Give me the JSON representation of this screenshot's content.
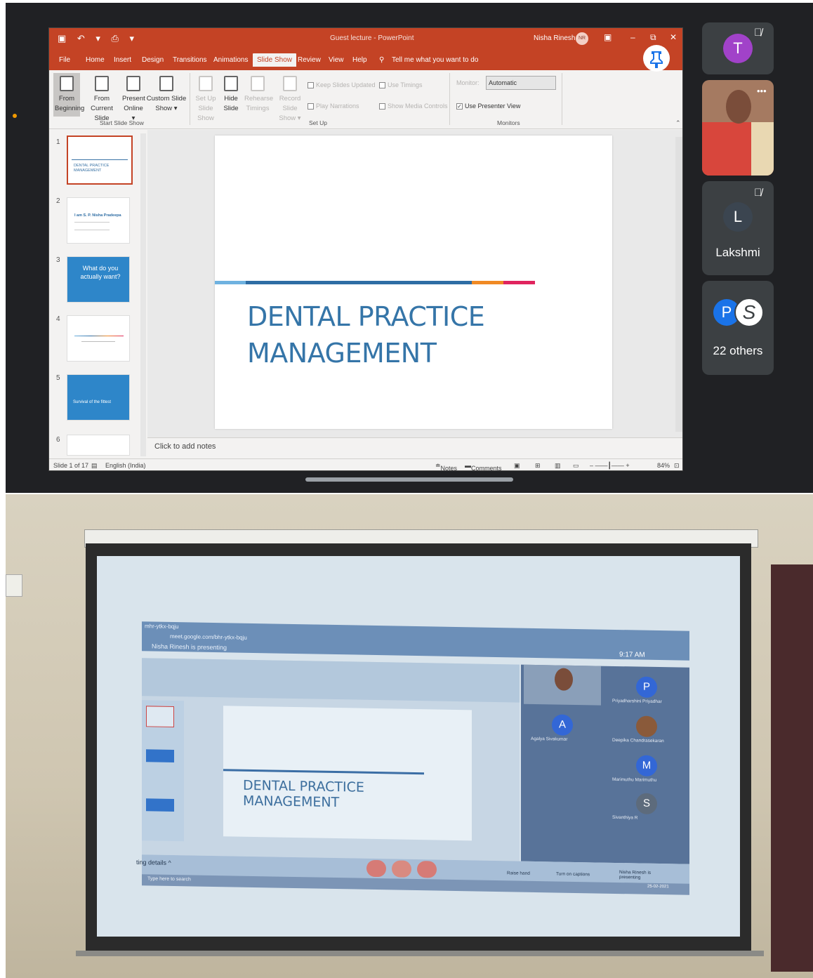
{
  "top": {
    "powerpoint": {
      "doc_title": "Guest lecture - PowerPoint",
      "user_name": "Nisha Rinesh",
      "user_initials": "NR",
      "tabs": [
        "File",
        "Home",
        "Insert",
        "Design",
        "Transitions",
        "Animations",
        "Slide Show",
        "Review",
        "View",
        "Help"
      ],
      "active_tab": "Slide Show",
      "tell_me": "Tell me what you want to do",
      "ribbon": {
        "from_beginning": [
          "From",
          "Beginning"
        ],
        "from_current": [
          "From",
          "Current Slide"
        ],
        "present_online": [
          "Present",
          "Online ▾"
        ],
        "custom_show": [
          "Custom Slide",
          "Show ▾"
        ],
        "set_up_show": [
          "Set Up",
          "Slide Show"
        ],
        "hide_slide": [
          "Hide",
          "Slide"
        ],
        "rehearse": [
          "Rehearse",
          "Timings"
        ],
        "record": [
          "Record Slide",
          "Show ▾"
        ],
        "keep_updated": "Keep Slides Updated",
        "use_timings": "Use Timings",
        "play_narrations": "Play Narrations",
        "show_media": "Show Media Controls",
        "monitor_label": "Monitor:",
        "monitor_value": "Automatic",
        "use_presenter_view": "Use Presenter View",
        "group_start": "Start Slide Show",
        "group_setup": "Set Up",
        "group_monitors": "Monitors"
      },
      "thumbnails": [
        {
          "num": "1",
          "text": "DENTAL PRACTICE MANAGEMENT"
        },
        {
          "num": "2",
          "text": "I am S. P. Nisha Pradeepa"
        },
        {
          "num": "3",
          "text": "What do you actually want?"
        },
        {
          "num": "4",
          "text": ""
        },
        {
          "num": "5",
          "text": "Survival of the fittest"
        },
        {
          "num": "6",
          "text": ""
        }
      ],
      "slide": {
        "title_line1": "DENTAL PRACTICE",
        "title_line2": "MANAGEMENT",
        "bar_colors": [
          "#6fb2e0",
          "#2e6da4",
          "#f08a24",
          "#e0245e"
        ]
      },
      "notes_placeholder": "Click to add notes",
      "status": {
        "slide_count": "Slide 1 of 17",
        "language": "English (India)",
        "notes": "Notes",
        "comments": "Comments",
        "zoom": "84%"
      }
    },
    "participants": [
      {
        "initial": "T",
        "color": "#a142c9",
        "muted": true,
        "name": ""
      },
      {
        "initial": "",
        "color": "#c44",
        "muted": false,
        "name": "",
        "video": true
      },
      {
        "initial": "L",
        "color": "#3b4550",
        "muted": true,
        "name": "Lakshmi"
      },
      {
        "initial": "P",
        "color": "#1a73e8",
        "muted": false,
        "name": "22 others"
      }
    ]
  },
  "projected": {
    "tab_title": "mhr-ytkx-bqju",
    "url": "meet.google.com/bhr-ytkx-bqju",
    "presenting": "Nisha Rinesh is presenting",
    "time": "9:17 AM",
    "slide_title_line1": "DENTAL PRACTICE",
    "slide_title_line2": "MANAGEMENT",
    "meeting_details": "ting details ^",
    "search": "Type here to search",
    "people": [
      {
        "initial": "P",
        "name": "Priyadharshini Priyadhar",
        "color": "#3367d6"
      },
      {
        "initial": "A",
        "name": "Agalya Sivakumar",
        "color": "#3367d6"
      },
      {
        "initial": "",
        "name": "Deepika Chandrasekaran",
        "color": "#8a5a3a"
      },
      {
        "initial": "M",
        "name": "Marimuthu Marimuthu",
        "color": "#3367d6"
      },
      {
        "initial": "S",
        "name": "Sivanthiya R",
        "color": "#5d6b7c"
      }
    ],
    "controls": [
      "Raise hand",
      "Turn on captions",
      "Nisha Rinesh is presenting"
    ],
    "date": "25-02-2021"
  }
}
